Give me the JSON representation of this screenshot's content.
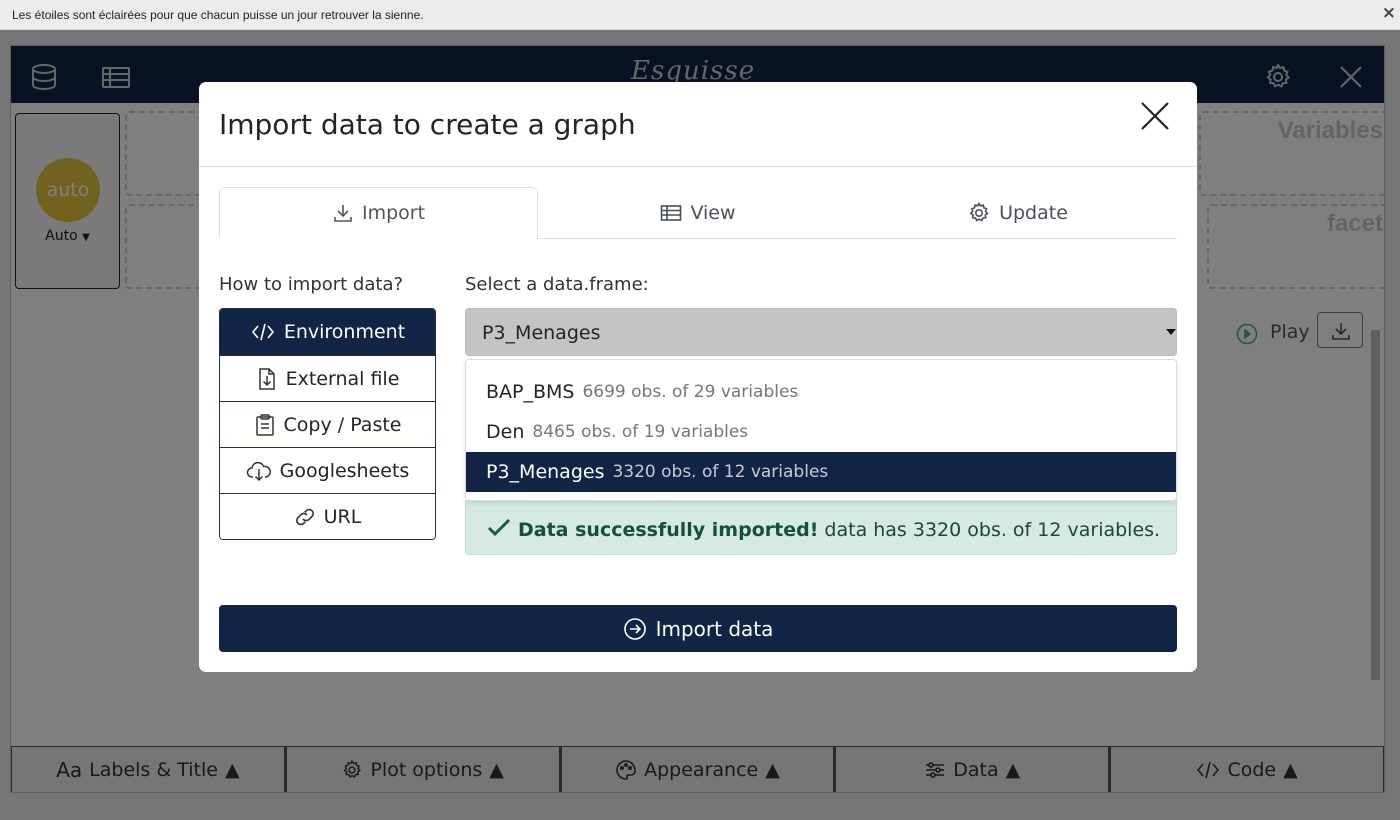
{
  "notice": {
    "text": "Les étoiles sont éclairées pour que chacun puisse un jour retrouver la sienne.",
    "close": "×"
  },
  "app": {
    "title": "Esquisse",
    "geom": {
      "circle_label": "auto",
      "select_label": "Auto"
    },
    "drop_zones": {
      "variables": "Variables",
      "facet": "facet"
    },
    "play_label": "Play",
    "bottom_bar": [
      {
        "label": "Labels & Title",
        "icon": "text-aa-icon"
      },
      {
        "label": "Plot options",
        "icon": "gear-icon"
      },
      {
        "label": "Appearance",
        "icon": "palette-icon"
      },
      {
        "label": "Data",
        "icon": "sliders-icon"
      },
      {
        "label": "Code",
        "icon": "code-icon"
      }
    ]
  },
  "modal": {
    "title": "Import data to create a graph",
    "tabs": [
      {
        "label": "Import",
        "icon": "download-icon",
        "active": true
      },
      {
        "label": "View",
        "icon": "table-icon",
        "active": false
      },
      {
        "label": "Update",
        "icon": "gear-icon",
        "active": false
      }
    ],
    "how_label": "How to import data?",
    "methods": [
      {
        "label": "Environment",
        "icon": "code-icon",
        "active": true
      },
      {
        "label": "External file",
        "icon": "file-import-icon",
        "active": false
      },
      {
        "label": "Copy / Paste",
        "icon": "clipboard-icon",
        "active": false
      },
      {
        "label": "Googlesheets",
        "icon": "cloud-download-icon",
        "active": false
      },
      {
        "label": "URL",
        "icon": "link-icon",
        "active": false
      }
    ],
    "select_label": "Select a data.frame:",
    "selected": "P3_Menages",
    "options": [
      {
        "name": "BAP_BMS",
        "meta": "6699 obs. of 29 variables",
        "selected": false
      },
      {
        "name": "Den",
        "meta": "8465 obs. of 19 variables",
        "selected": false
      },
      {
        "name": "P3_Menages",
        "meta": "3320 obs. of 12 variables",
        "selected": true
      }
    ],
    "alert": {
      "strong": "Data successfully imported!",
      "text": " data has 3320 obs. of 12 variables."
    },
    "import_button": "Import data"
  },
  "colors": {
    "navy": "#112446",
    "accent_yellow": "#e5c43f",
    "success_bg": "#d5ebe2"
  }
}
